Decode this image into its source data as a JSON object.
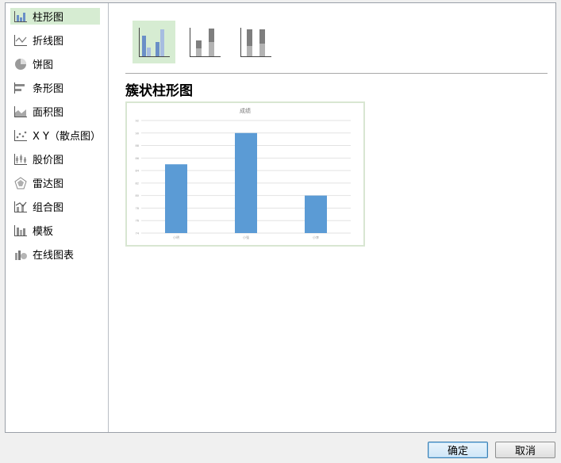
{
  "sidebar": {
    "items": [
      {
        "label": "柱形图",
        "icon": "bar-chart-icon"
      },
      {
        "label": "折线图",
        "icon": "line-chart-icon"
      },
      {
        "label": "饼图",
        "icon": "pie-chart-icon"
      },
      {
        "label": "条形图",
        "icon": "horizontal-bar-icon"
      },
      {
        "label": "面积图",
        "icon": "area-chart-icon"
      },
      {
        "label": "X Y（散点图）",
        "icon": "scatter-chart-icon"
      },
      {
        "label": "股价图",
        "icon": "stock-chart-icon"
      },
      {
        "label": "雷达图",
        "icon": "radar-chart-icon"
      },
      {
        "label": "组合图",
        "icon": "combo-chart-icon"
      },
      {
        "label": "模板",
        "icon": "template-icon"
      },
      {
        "label": "在线图表",
        "icon": "online-chart-icon"
      }
    ],
    "selected_index": 0
  },
  "subtypes": {
    "title": "簇状柱形图",
    "selected_index": 0
  },
  "chart_data": {
    "type": "bar",
    "title": "成绩",
    "categories": [
      "小明",
      "小强",
      "小李"
    ],
    "values": [
      85,
      90,
      80
    ],
    "ylim": [
      74,
      92
    ],
    "yticks": [
      "74",
      "76",
      "78",
      "80",
      "82",
      "84",
      "86",
      "88",
      "90",
      "92"
    ],
    "grid": true,
    "bar_color": "#5b9bd5"
  },
  "buttons": {
    "ok": "确定",
    "cancel": "取消"
  },
  "colors": {
    "selected_bg": "#d6ecd2",
    "accent": "#5b9bd5"
  }
}
